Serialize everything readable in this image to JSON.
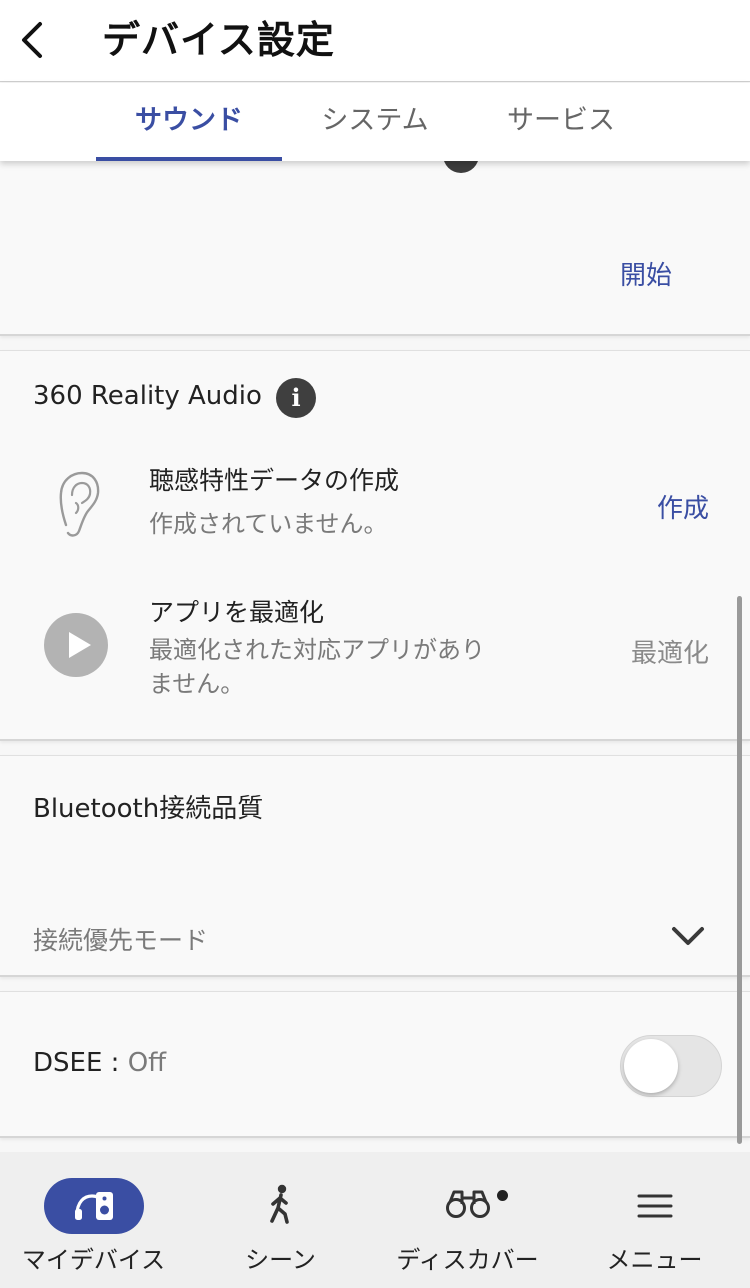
{
  "header": {
    "title": "デバイス設定"
  },
  "tabs": [
    {
      "label": "サウンド",
      "active": true
    },
    {
      "label": "システム",
      "active": false
    },
    {
      "label": "サービス",
      "active": false
    }
  ],
  "start_section": {
    "start_label": "開始"
  },
  "reality_audio": {
    "title": "360 Reality Audio",
    "hearing_profile": {
      "title": "聴感特性データの作成",
      "status": "作成されていません。",
      "action": "作成"
    },
    "optimize_apps": {
      "title": "アプリを最適化",
      "status_line1": "最適化された対応アプリがあり",
      "status_line2": "ません。",
      "action": "最適化"
    }
  },
  "bluetooth": {
    "title": "Bluetooth接続品質",
    "selected": "接続優先モード"
  },
  "dsee": {
    "label": "DSEE",
    "separator": " : ",
    "value": "Off",
    "enabled": false
  },
  "bottom_nav": [
    {
      "label": "マイデバイス",
      "icon": "my-device-icon",
      "active": true
    },
    {
      "label": "シーン",
      "icon": "walking-person-icon",
      "active": false
    },
    {
      "label": "ディスカバー",
      "icon": "binoculars-icon",
      "active": false,
      "notification_dot": true
    },
    {
      "label": "メニュー",
      "icon": "menu-icon",
      "active": false
    }
  ],
  "colors": {
    "accent": "#3a4ea3",
    "background": "#f7f7f7",
    "muted_text": "#7a7a7a"
  }
}
